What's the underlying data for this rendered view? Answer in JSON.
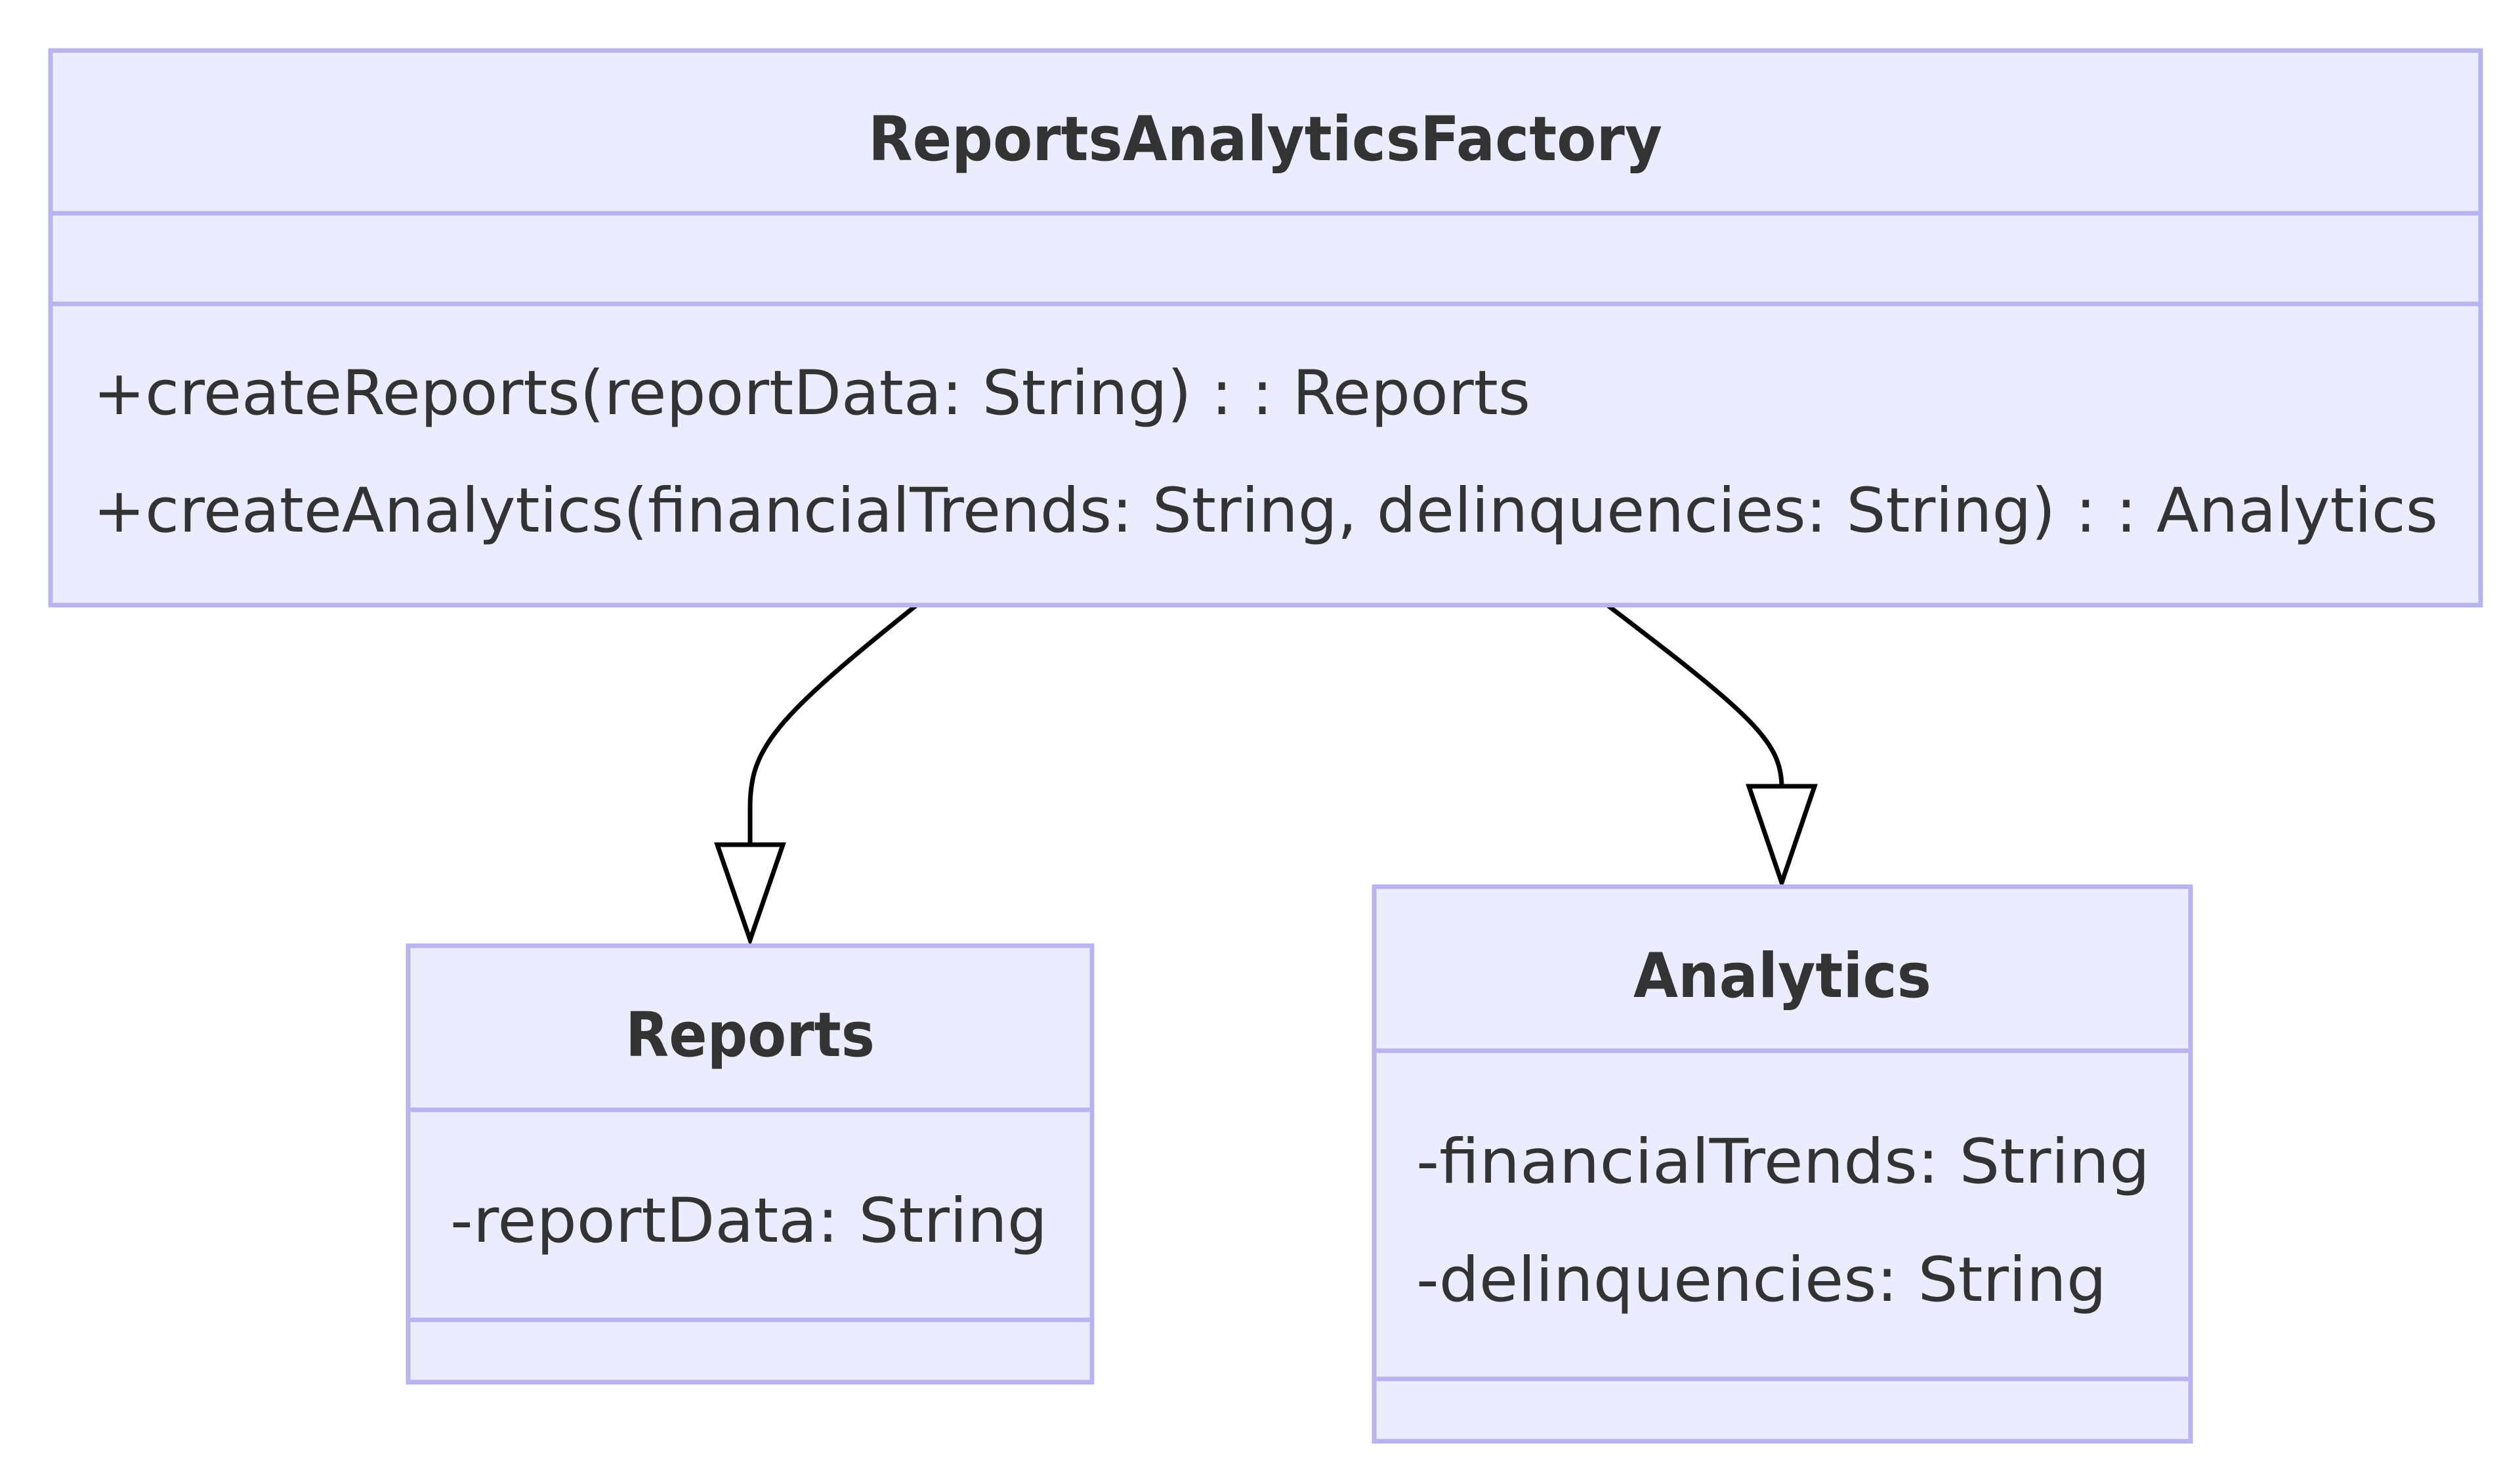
{
  "classes": {
    "factory": {
      "name": "ReportsAnalyticsFactory",
      "attributes": [],
      "methods": [
        "+createReports(reportData: String) : : Reports",
        "+createAnalytics(financialTrends: String, delinquencies: String) : : Analytics"
      ]
    },
    "reports": {
      "name": "Reports",
      "attributes": [
        "-reportData: String"
      ],
      "methods": []
    },
    "analytics": {
      "name": "Analytics",
      "attributes": [
        "-financialTrends: String",
        "-delinquencies: String"
      ],
      "methods": []
    }
  },
  "relations": [
    {
      "from": "factory",
      "to": "reports",
      "type": "inheritance"
    },
    {
      "from": "factory",
      "to": "analytics",
      "type": "inheritance"
    }
  ],
  "colors": {
    "class_fill": "#ececff",
    "class_stroke": "#b7b4ef",
    "text": "#333333",
    "edge": "#000000"
  }
}
